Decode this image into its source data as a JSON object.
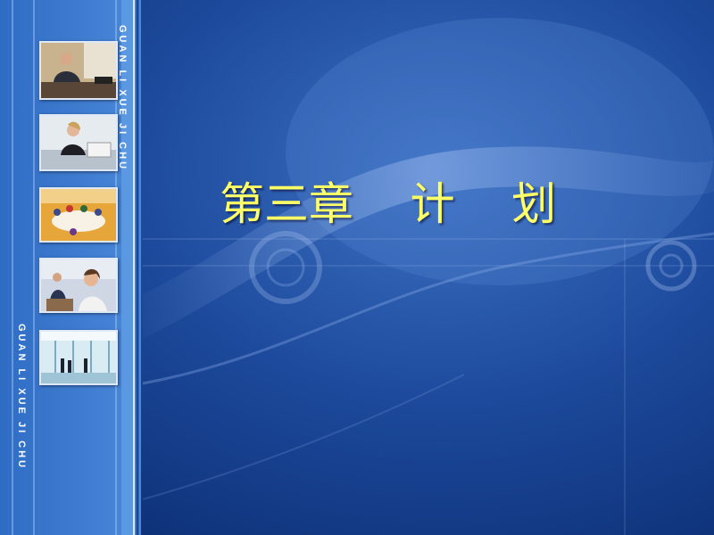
{
  "slide": {
    "title": "第三章    计    划",
    "sidebar_text_top": "GUAN LI XUE JI CHU",
    "sidebar_text_bottom": "GUAN LI XUE JI CHU"
  },
  "colors": {
    "background": "#123d8a",
    "sidebar": "#3f7fd4",
    "title": "#ffff66"
  },
  "photos": [
    "office-phone-man-photo",
    "office-phone-woman-photo",
    "meeting-room-photo",
    "call-center-photo",
    "office-lobby-photo"
  ]
}
